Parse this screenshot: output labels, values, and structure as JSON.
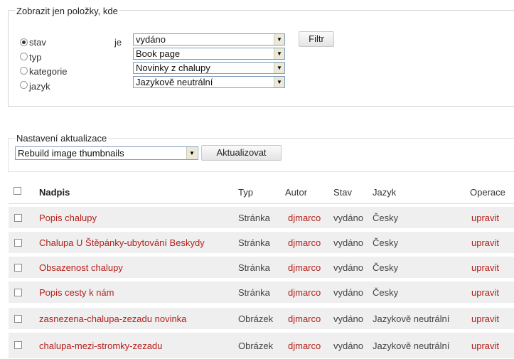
{
  "filter": {
    "legend": "Zobrazit jen položky, kde",
    "conditions": [
      {
        "label": "stav",
        "selected": true,
        "value": "vydáno"
      },
      {
        "label": "typ",
        "selected": false,
        "value": "Book page"
      },
      {
        "label": "kategorie",
        "selected": false,
        "value": "Novinky z chalupy"
      },
      {
        "label": "jazyk",
        "selected": false,
        "value": "Jazykově neutrální"
      }
    ],
    "operator": "je",
    "button": "Filtr"
  },
  "update": {
    "legend": "Nastavení aktualizace",
    "selected": "Rebuild image thumbnails",
    "button": "Aktualizovat"
  },
  "table": {
    "headers": {
      "title": "Nadpis",
      "type": "Typ",
      "author": "Autor",
      "status": "Stav",
      "language": "Jazyk",
      "operations": "Operace"
    },
    "rows": [
      {
        "title": "Popis chalupy",
        "type": "Stránka",
        "author": "djmarco",
        "status": "vydáno",
        "language": "Česky",
        "operation": "upravit"
      },
      {
        "title": "Chalupa U Štěpánky-ubytování Beskydy",
        "type": "Stránka",
        "author": "djmarco",
        "status": "vydáno",
        "language": "Česky",
        "operation": "upravit"
      },
      {
        "title": "Obsazenost chalupy",
        "type": "Stránka",
        "author": "djmarco",
        "status": "vydáno",
        "language": "Česky",
        "operation": "upravit"
      },
      {
        "title": "Popis cesty k nám",
        "type": "Stránka",
        "author": "djmarco",
        "status": "vydáno",
        "language": "Česky",
        "operation": "upravit"
      },
      {
        "title": "zasnezena-chalupa-zezadu novinka",
        "type": "Obrázek",
        "author": "djmarco",
        "status": "vydáno",
        "language": "Jazykově neutrální",
        "operation": "upravit"
      },
      {
        "title": "chalupa-mezi-stromky-zezadu",
        "type": "Obrázek",
        "author": "djmarco",
        "status": "vydáno",
        "language": "Jazykově neutrální",
        "operation": "upravit"
      }
    ]
  },
  "icons": {
    "dropdown": "triangle-down-icon"
  }
}
